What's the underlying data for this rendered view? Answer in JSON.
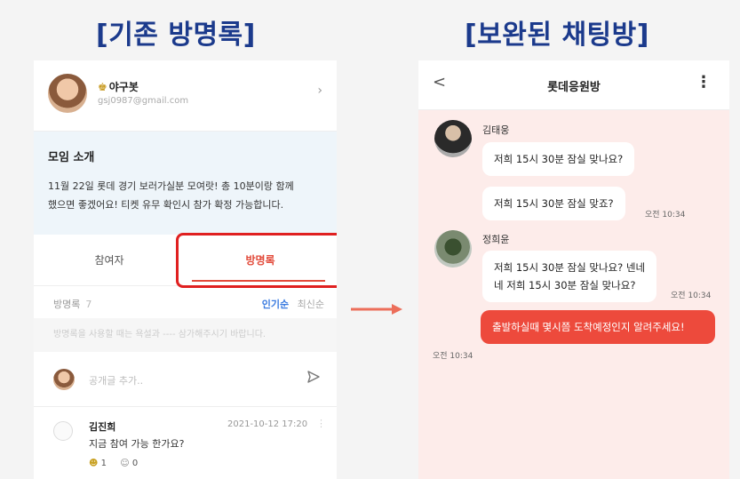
{
  "titles": {
    "left": "[기존 방명록]",
    "right": "[보완된 채팅방]"
  },
  "left": {
    "profile": {
      "name": "야구봇",
      "email": "gsj0987@gmail.com",
      "chevron": "›",
      "badge_icon": "crown-icon"
    },
    "intro": {
      "title": "모임 소개",
      "line1": "11월 22일 롯데 경기 보러가실분 모여랏! 총 10분이랑 함께",
      "line2": "했으면 좋겠어요! 티켓 유무 확인시 참가 확정 가능합니다."
    },
    "tabs": {
      "participants": "참여자",
      "guestbook": "방명록"
    },
    "guestbook": {
      "title": "방명록",
      "count": "7",
      "sort_popular": "인기순",
      "sort_recent": "최신순",
      "notice": "방명록을 사용할 때는 욕설과 ---- 삼가해주시기 바랍니다.",
      "input_placeholder": "공개글 추가..",
      "send_icon": "send-icon"
    },
    "post": {
      "author": "김진희",
      "time": "2021-10-12 17:20",
      "text": "지금 참여 가능 한가요?",
      "likes": "1",
      "reactions": "0"
    }
  },
  "right": {
    "header": {
      "back": "<",
      "title": "롯데응원방",
      "menu": "⋮"
    },
    "messages": {
      "sender1": "김태웅",
      "m1": "저희 15시 30분 잠실 맞나요?",
      "m2": "저희 15시 30분 잠실 맞죠?",
      "t2": "오전 10:34",
      "sender2": "정희윤",
      "m3a": "저희 15시 30분 잠실 맞나요? 넨네",
      "m3b": "네 저희 15시 30분 잠실 맞나요?",
      "t3": "오전 10:34",
      "m4": "출발하실때 몇시쯤 도착예정인지 알려주세요!",
      "t4": "오전 10:34"
    }
  },
  "colors": {
    "title": "#1b3a8c",
    "accent_red": "#e24a3a",
    "highlight": "#e02020",
    "chat_bg": "#fdecea",
    "my_bubble": "#ed4a3c",
    "link_blue": "#3a7be0"
  }
}
